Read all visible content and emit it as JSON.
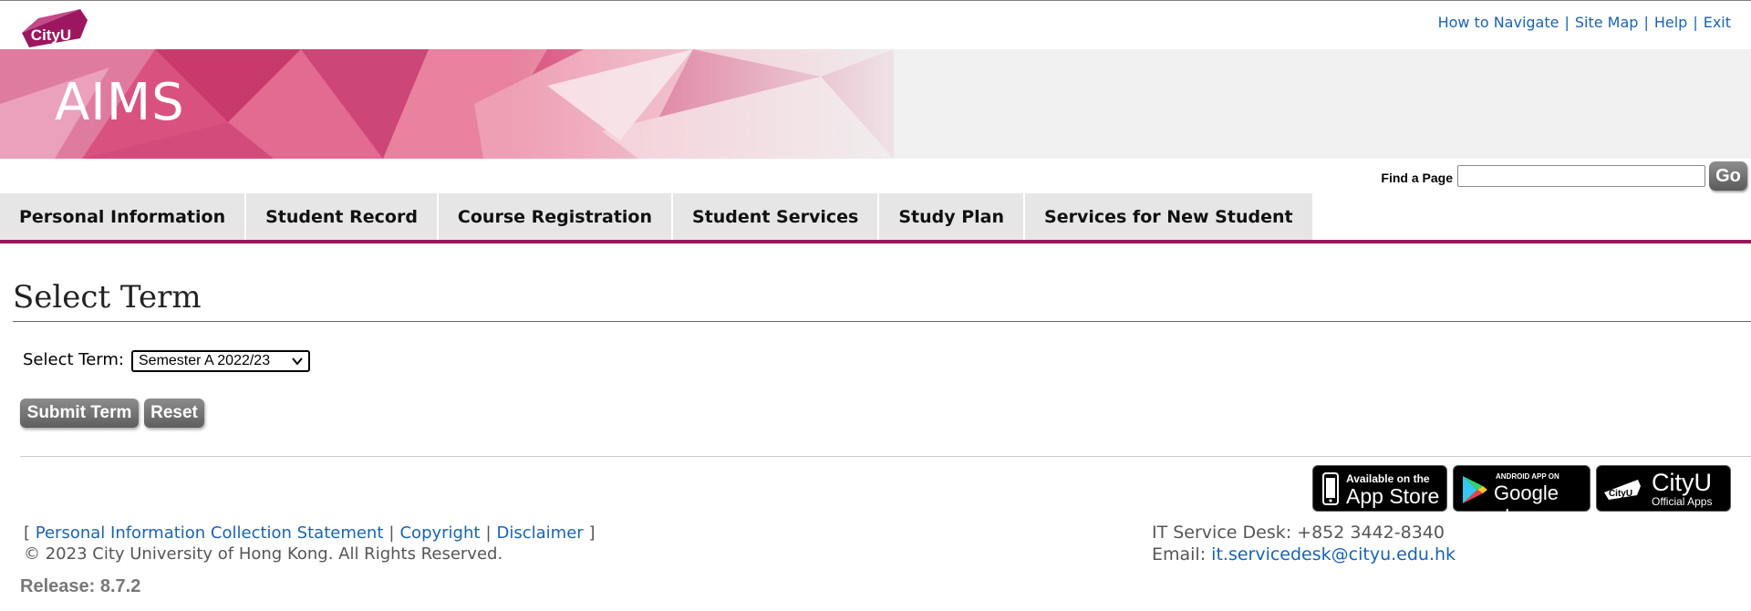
{
  "brand": {
    "logo_text": "CityU",
    "app_title": "AIMS",
    "accent": "#9d1660"
  },
  "top_links": [
    {
      "label": "How to Navigate"
    },
    {
      "label": "Site Map"
    },
    {
      "label": "Help"
    },
    {
      "label": "Exit"
    }
  ],
  "find": {
    "label": "Find a Page",
    "value": "",
    "go_label": "Go"
  },
  "nav": {
    "tabs": [
      {
        "label": "Personal Information"
      },
      {
        "label": "Student Record"
      },
      {
        "label": "Course Registration"
      },
      {
        "label": "Student Services"
      },
      {
        "label": "Study Plan"
      },
      {
        "label": "Services for New Student"
      }
    ]
  },
  "main": {
    "title": "Select Term",
    "term_label": "Select Term:",
    "term_selected": "Semester A 2022/23",
    "submit_label": "Submit Term",
    "reset_label": "Reset"
  },
  "badges": {
    "app_store": {
      "line1": "Available on the",
      "line2": "App Store"
    },
    "google_play": {
      "line1": "ANDROID APP ON",
      "line2": "Google play"
    },
    "cityu_app": {
      "logo": "CityU",
      "line1": "CityU",
      "line2": "Official Apps"
    }
  },
  "footer": {
    "links": [
      {
        "label": "Personal Information Collection Statement"
      },
      {
        "label": "Copyright"
      },
      {
        "label": "Disclaimer"
      }
    ],
    "copyright": "© 2023 City University of Hong Kong. All Rights Reserved.",
    "release": "Release: 8.7.2",
    "desk": "IT Service Desk: +852 3442-8340",
    "email_label": "Email:",
    "email": "it.servicedesk@cityu.edu.hk"
  }
}
